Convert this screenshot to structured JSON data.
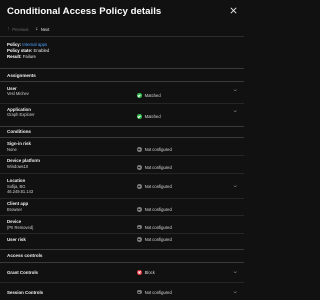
{
  "header": {
    "title": "Conditional Access Policy details"
  },
  "nav": {
    "previous_label": "Previous",
    "next_label": "Next"
  },
  "policy": {
    "policy_label": "Policy:",
    "policy_value": "Internal apps",
    "state_label": "Policy state:",
    "state_value": "Enabled",
    "result_label": "Result:",
    "result_value": "Failure"
  },
  "assignments": {
    "heading": "Assignments",
    "user": {
      "label": "User",
      "value": "Vesl Michev",
      "status": "Matched"
    },
    "application": {
      "label": "Application",
      "value": "Graph Explorer",
      "status": "Matched"
    }
  },
  "conditions": {
    "heading": "Conditions",
    "sign_in_risk": {
      "label": "Sign-in risk",
      "value": "None",
      "status": "Not configured"
    },
    "device_platform": {
      "label": "Device platform",
      "value": "Windows10",
      "status": "Not configured"
    },
    "location": {
      "label": "Location",
      "value_line1": "Sofija, BG",
      "value_line2": "46.249.81.143",
      "status": "Not configured"
    },
    "client_app": {
      "label": "Client app",
      "value": "Browser",
      "status": "Not configured"
    },
    "device": {
      "label": "Device",
      "value": "(PII Removed)",
      "status": "Not configured"
    },
    "user_risk": {
      "label": "User risk",
      "status": "Not configured"
    }
  },
  "access_controls": {
    "heading": "Access controls",
    "grant": {
      "label": "Grant Controls",
      "status": "Block"
    },
    "session": {
      "label": "Session Controls",
      "status": "Not configured"
    }
  },
  "colors": {
    "matched": "#2fb84a",
    "not_configured": "#7a7a7a",
    "block": "#e2323a",
    "link": "#4ea2ff",
    "background": "#111111"
  },
  "icons": {
    "close": "close-icon",
    "previous": "arrow-up-icon",
    "next": "arrow-down-icon",
    "expand": "chevron-down-icon"
  }
}
